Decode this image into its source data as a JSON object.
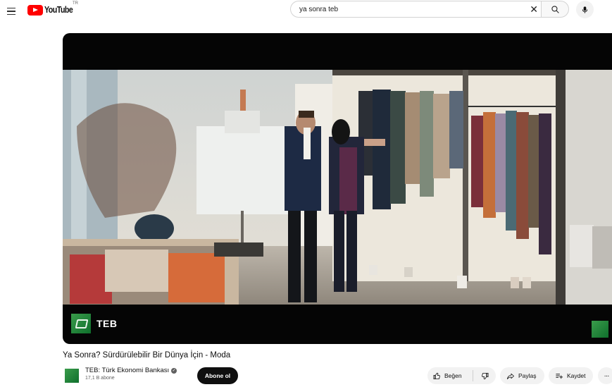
{
  "header": {
    "logo_text": "YouTube",
    "logo_tm": "TR",
    "search_value": "ya sonra teb",
    "icons": [
      "menu-icon",
      "youtube-logo",
      "clear-icon",
      "search-icon",
      "mic-icon"
    ]
  },
  "player": {
    "brand_text": "TEB"
  },
  "video": {
    "title": "Ya Sonra? Sürdürülebilir Bir Dünya İçin - Moda"
  },
  "channel": {
    "name": "TEB: Türk Ekonomi Bankası",
    "subscribers": "17,1 B abone",
    "subscribe_label": "Abone ol"
  },
  "actions": {
    "like_label": "Beğen",
    "share_label": "Paylaş",
    "save_label": "Kaydet",
    "more_label": "···"
  },
  "colors": {
    "brand_green": "#1f8a3a",
    "youtube_red": "#ff0000",
    "button_bg": "#f2f2f2"
  }
}
